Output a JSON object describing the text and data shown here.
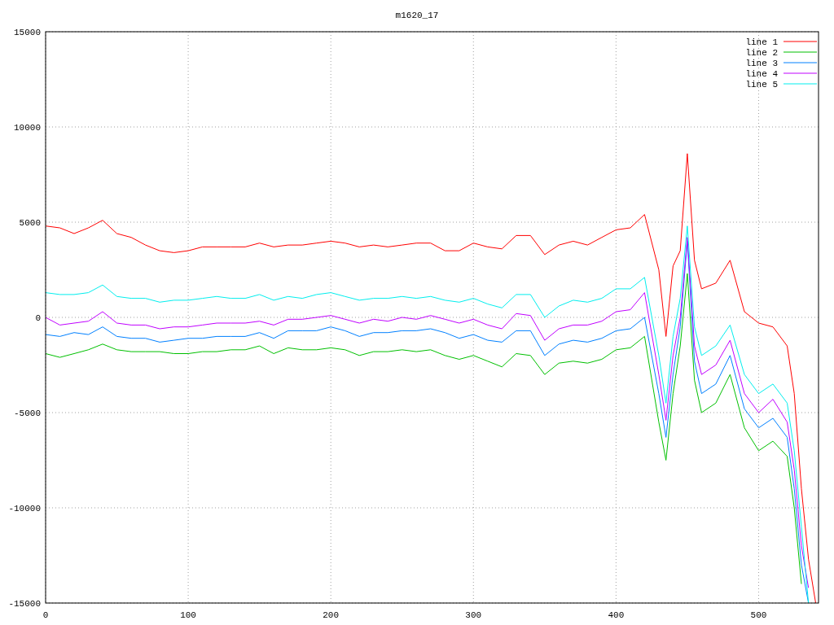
{
  "plot": {
    "chart_data": {
      "type": "line",
      "title": "m1620_17",
      "x": [
        0,
        10,
        20,
        30,
        40,
        50,
        60,
        70,
        80,
        90,
        100,
        110,
        120,
        130,
        140,
        150,
        160,
        170,
        180,
        190,
        200,
        210,
        220,
        230,
        240,
        250,
        260,
        270,
        280,
        290,
        300,
        310,
        320,
        330,
        340,
        350,
        360,
        370,
        380,
        390,
        400,
        410,
        420,
        430,
        435,
        440,
        445,
        450,
        455,
        460,
        470,
        480,
        490,
        500,
        510,
        520,
        525,
        530,
        535,
        540
      ],
      "series": [
        {
          "name": "line 1",
          "color": "#ff0000",
          "values": [
            4800,
            4700,
            4400,
            4700,
            5100,
            4400,
            4200,
            3800,
            3500,
            3400,
            3500,
            3700,
            3700,
            3700,
            3700,
            3900,
            3700,
            3800,
            3800,
            3900,
            4000,
            3900,
            3700,
            3800,
            3700,
            3800,
            3900,
            3900,
            3500,
            3500,
            3900,
            3700,
            3600,
            4300,
            4300,
            3300,
            3800,
            4000,
            3800,
            4200,
            4600,
            4700,
            5400,
            2500,
            -1000,
            2700,
            3500,
            8600,
            3000,
            1500,
            1800,
            3000,
            300,
            -300,
            -500,
            -1500,
            -4000,
            -9000,
            -12700,
            -15000
          ]
        },
        {
          "name": "line 2",
          "color": "#00c000",
          "values": [
            -1900,
            -2100,
            -1900,
            -1700,
            -1400,
            -1700,
            -1800,
            -1800,
            -1800,
            -1900,
            -1900,
            -1800,
            -1800,
            -1700,
            -1700,
            -1500,
            -1900,
            -1600,
            -1700,
            -1700,
            -1600,
            -1700,
            -2000,
            -1800,
            -1800,
            -1700,
            -1800,
            -1700,
            -2000,
            -2200,
            -2000,
            -2300,
            -2600,
            -1900,
            -2000,
            -3000,
            -2400,
            -2300,
            -2400,
            -2200,
            -1700,
            -1600,
            -1000,
            -5500,
            -7500,
            -4000,
            -1500,
            2300,
            -3300,
            -5000,
            -4500,
            -3000,
            -5800,
            -7000,
            -6500,
            -7300,
            -10000,
            -14000,
            null,
            null
          ]
        },
        {
          "name": "line 3",
          "color": "#0080ff",
          "values": [
            -900,
            -1000,
            -800,
            -900,
            -500,
            -1000,
            -1100,
            -1100,
            -1300,
            -1200,
            -1100,
            -1100,
            -1000,
            -1000,
            -1000,
            -800,
            -1100,
            -700,
            -700,
            -700,
            -500,
            -700,
            -1000,
            -800,
            -800,
            -700,
            -700,
            -600,
            -800,
            -1100,
            -900,
            -1200,
            -1300,
            -700,
            -700,
            -2000,
            -1400,
            -1200,
            -1300,
            -1100,
            -700,
            -600,
            0,
            -4000,
            -6300,
            -3000,
            -500,
            4000,
            -2300,
            -4000,
            -3500,
            -2000,
            -4800,
            -5800,
            -5300,
            -6300,
            -9000,
            -13000,
            -15000,
            null
          ]
        },
        {
          "name": "line 4",
          "color": "#c000ff",
          "values": [
            0,
            -400,
            -300,
            -200,
            300,
            -300,
            -400,
            -400,
            -600,
            -500,
            -500,
            -400,
            -300,
            -300,
            -300,
            -200,
            -400,
            -100,
            -100,
            0,
            100,
            -100,
            -300,
            -100,
            -200,
            0,
            -100,
            100,
            -100,
            -300,
            -100,
            -400,
            -600,
            200,
            100,
            -1200,
            -600,
            -400,
            -400,
            -200,
            300,
            400,
            1300,
            -3000,
            -5400,
            -2000,
            0,
            4200,
            -1500,
            -3000,
            -2500,
            -1200,
            -4000,
            -5000,
            -4300,
            -5500,
            -8000,
            -12000,
            -14200,
            null
          ]
        },
        {
          "name": "line 5",
          "color": "#00eeee",
          "values": [
            1300,
            1200,
            1200,
            1300,
            1700,
            1100,
            1000,
            1000,
            800,
            900,
            900,
            1000,
            1100,
            1000,
            1000,
            1200,
            900,
            1100,
            1000,
            1200,
            1300,
            1100,
            900,
            1000,
            1000,
            1100,
            1000,
            1100,
            900,
            800,
            1000,
            700,
            500,
            1200,
            1200,
            0,
            600,
            900,
            800,
            1000,
            1500,
            1500,
            2100,
            -2000,
            -4500,
            -1000,
            1000,
            4800,
            -500,
            -2000,
            -1500,
            -400,
            -3000,
            -4000,
            -3500,
            -4500,
            -7000,
            -11000,
            -15000,
            null
          ]
        }
      ],
      "grid": true,
      "legend": "top right",
      "xlim": [
        0,
        542
      ],
      "ylim": [
        -15000,
        15000
      ],
      "xticks": [
        0,
        100,
        200,
        300,
        400,
        500
      ],
      "yticks": [
        -15000,
        -10000,
        -5000,
        0,
        5000,
        10000,
        15000
      ]
    }
  }
}
